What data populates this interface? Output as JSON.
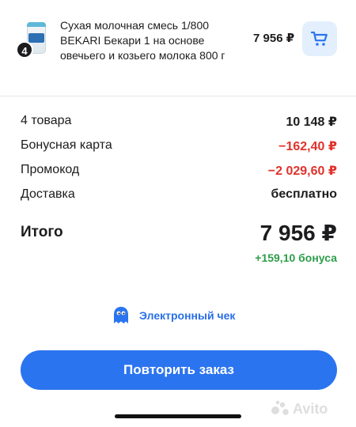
{
  "product": {
    "name": "Сухая молочная смесь 1/800 BEKARI Бекари 1 на основе овечьего и козьего молока 800 г",
    "quantity": "4",
    "price": "7 956 ₽"
  },
  "summary": {
    "rows": [
      {
        "label": "4 товара",
        "value": "10 148 ₽"
      },
      {
        "label": "Бонусная карта",
        "value": "−162,40 ₽"
      },
      {
        "label": "Промокод",
        "value": "−2 029,60 ₽"
      },
      {
        "label": "Доставка",
        "value": "бесплатно"
      }
    ],
    "total_label": "Итого",
    "total_value": "7 956 ₽",
    "bonus": "+159,10 бонуса"
  },
  "receipt": {
    "label": "Электронный чек"
  },
  "actions": {
    "repeat_label": "Повторить заказ"
  },
  "watermark": {
    "text": "Avito"
  },
  "colors": {
    "accent": "#2b74ef",
    "discount": "#e0322c",
    "bonus": "#2e9d4a",
    "cart_button_bg": "#e3effd"
  },
  "icons": [
    "product-thumbnail",
    "cart-icon",
    "receipt-ghost-icon"
  ]
}
